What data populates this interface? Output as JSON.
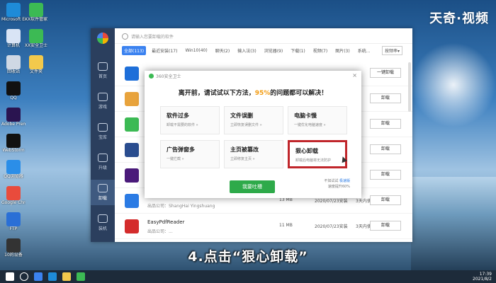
{
  "watermark": "天奇·视频",
  "desktop_icons": [
    {
      "label": "Microsoft Edge",
      "color": "#1e8bd8"
    },
    {
      "label": "计算机",
      "color": "#d9e4f5"
    },
    {
      "label": "回收站",
      "color": "#cfd8e4"
    },
    {
      "label": "QQ",
      "color": "#111"
    },
    {
      "label": "Adobe Premiere",
      "color": "#2a1450"
    },
    {
      "label": "WebStorm",
      "color": "#111"
    },
    {
      "label": "QQ浏览器",
      "color": "#2b8ee8"
    },
    {
      "label": "Google Chrome",
      "color": "#e94b3c"
    },
    {
      "label": "FTP",
      "color": "#2a6fd6"
    },
    {
      "label": "10的设备",
      "color": "#333"
    },
    {
      "label": "XX软件管家",
      "color": "#3cba54"
    },
    {
      "label": "XX安全卫士",
      "color": "#3cba54"
    },
    {
      "label": "文件夹",
      "color": "#f2c94c"
    }
  ],
  "app": {
    "search_placeholder": "请输入您要卸载的软件",
    "sidebar": [
      {
        "label": "首页"
      },
      {
        "label": "游戏"
      },
      {
        "label": "宝库"
      },
      {
        "label": "升级"
      },
      {
        "label": "卸载"
      },
      {
        "label": "装机"
      }
    ],
    "tabs": [
      "全部(113)",
      "最近安装(17)",
      "Win10(40)",
      "聊天(2)",
      "输入法(3)",
      "浏览器(9)",
      "下载(1)",
      "视频(7)",
      "图片(3)",
      "系统..."
    ],
    "sort_label": "按频率▾",
    "rows": [
      {
        "name": "",
        "publisher": "",
        "size": "",
        "date": "",
        "usage": "",
        "button": "一键卸载",
        "color": "#1e6fd9"
      },
      {
        "name": "",
        "publisher": "",
        "size": "",
        "date": "",
        "usage": "",
        "button": "卸载",
        "color": "#e8a33c"
      },
      {
        "name": "",
        "publisher": "",
        "size": "",
        "date": "",
        "usage": "",
        "button": "卸载",
        "color": "#3cba54"
      },
      {
        "name": "",
        "publisher": "",
        "size": "",
        "date": "",
        "usage": "",
        "button": "卸载",
        "color": "#2a4d8f"
      },
      {
        "name": "",
        "publisher": "",
        "size": "",
        "date": "",
        "usage": "",
        "button": "卸载",
        "color": "#4a1a7a"
      },
      {
        "name": "DocTranslate",
        "publisher": "出品公司：ShangHai Yingshuang",
        "size": "13 MB",
        "date": "2020/07/23安装",
        "usage": "3天内使用过",
        "button": "卸载",
        "color": "#2b7be4"
      },
      {
        "name": "EasyPdfReader",
        "publisher": "出品公司：...",
        "size": "11 MB",
        "date": "2020/07/23安装",
        "usage": "3天内使用过",
        "button": "卸载",
        "color": "#d42c2c"
      }
    ]
  },
  "dialog": {
    "header": "360安全卫士",
    "close": "×",
    "title_prefix": "离开前，请试试以下方法，",
    "title_pct": "95%",
    "title_suffix": "的问题都可以解决！",
    "options": [
      {
        "title": "软件过多",
        "desc": "卸载不需要的软件 »"
      },
      {
        "title": "文件误删",
        "desc": "立即恢复误删文件 »"
      },
      {
        "title": "电脑卡慢",
        "desc": "一键优化电脑速度 »"
      },
      {
        "title": "广告弹窗多",
        "desc": "一键拦截 »"
      },
      {
        "title": "主页被篡改",
        "desc": "立即修复主页 »"
      },
      {
        "title": "狠心卸载",
        "desc": "卸载后电脑将无法防护"
      }
    ],
    "complain_button": "我要吐槽",
    "footer_line1": "不如试试",
    "footer_link": "极速版",
    "footer_line2": "速度提升60%"
  },
  "caption": "4.点击“狠心卸载”",
  "taskbar": {
    "time": "17:39",
    "date": "2021/8/2"
  }
}
